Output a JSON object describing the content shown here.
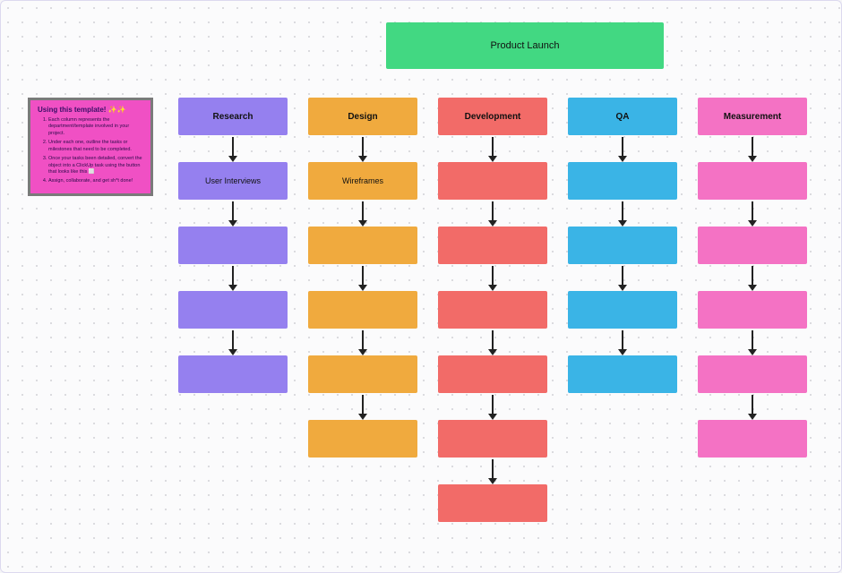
{
  "header": {
    "title": "Product Launch"
  },
  "sticky": {
    "title": "Using this template! ✨✨",
    "items": [
      "Each column represents the department/template involved in your project.",
      "Under each one, outline the tasks or milestones that need to be completed.",
      "Once your tasks been detailed, convert the object into a ClickUp task using the button that looks like this ⬜",
      "Assign, collaborate, and get sh*t done!"
    ]
  },
  "columns": [
    {
      "id": "research",
      "color": "purple",
      "boxes": [
        "Research",
        "User Interviews",
        "",
        "",
        ""
      ]
    },
    {
      "id": "design",
      "color": "orange",
      "boxes": [
        "Design",
        "Wireframes",
        "",
        "",
        "",
        ""
      ]
    },
    {
      "id": "development",
      "color": "red",
      "boxes": [
        "Development",
        "",
        "",
        "",
        "",
        "",
        ""
      ]
    },
    {
      "id": "qa",
      "color": "blue",
      "boxes": [
        "QA",
        "",
        "",
        "",
        ""
      ]
    },
    {
      "id": "measurement",
      "color": "pink",
      "boxes": [
        "Measurement",
        "",
        "",
        "",
        "",
        ""
      ]
    }
  ]
}
